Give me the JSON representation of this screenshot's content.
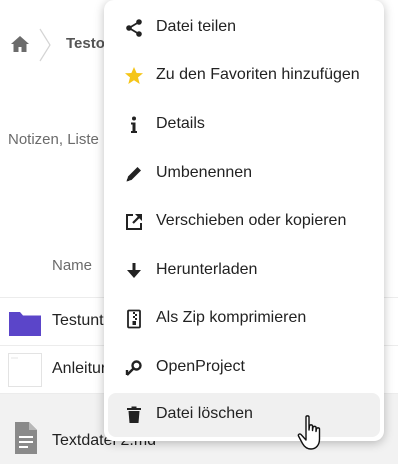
{
  "breadcrumb": {
    "folder_label": "Testo"
  },
  "description_text": "Notizen, Liste",
  "file_list": {
    "name_header": "Name",
    "rows": [
      {
        "name": "Testunt",
        "icon": "folder-icon"
      },
      {
        "name": "Anleitur",
        "icon": "document-thumbnail-icon"
      },
      {
        "name": "Textdatei 2.md",
        "icon": "text-file-icon"
      }
    ]
  },
  "context_menu": {
    "items": [
      {
        "label": "Datei teilen",
        "icon": "share-icon"
      },
      {
        "label": "Zu den Favoriten hinzufügen",
        "icon": "star-icon"
      },
      {
        "label": "Details",
        "icon": "info-icon"
      },
      {
        "label": "Umbenennen",
        "icon": "pencil-icon"
      },
      {
        "label": "Verschieben oder kopieren",
        "icon": "move-copy-icon"
      },
      {
        "label": "Herunterladen",
        "icon": "download-icon"
      },
      {
        "label": "Als Zip komprimieren",
        "icon": "zip-icon"
      },
      {
        "label": "OpenProject",
        "icon": "openproject-icon"
      },
      {
        "label": "Datei löschen",
        "icon": "trash-icon",
        "active": true
      }
    ]
  },
  "colors": {
    "folder": "#5b45c9",
    "star": "#f5c518",
    "menu_hover": "#f0f0f0",
    "selected_row": "#f2f2f2"
  }
}
